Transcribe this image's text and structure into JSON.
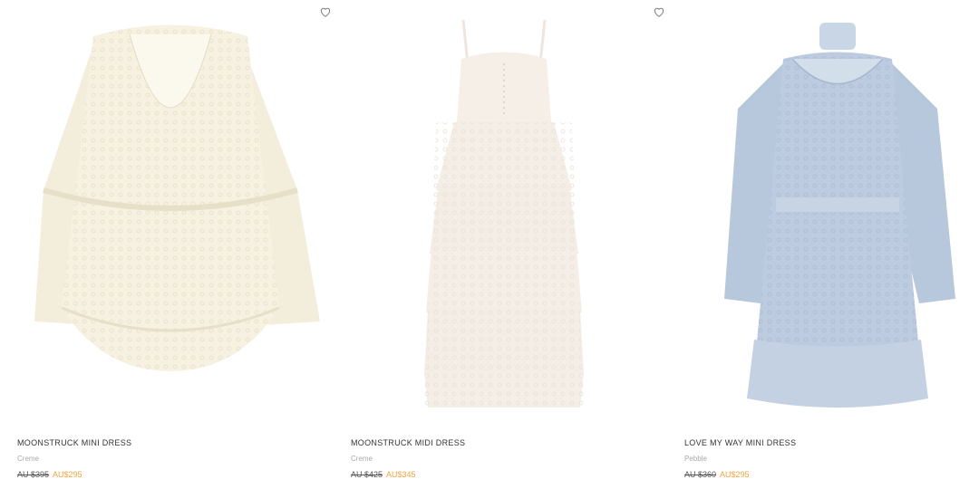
{
  "products": [
    {
      "name": "MOONSTRUCK MINI DRESS",
      "color": "Creme",
      "original_price": "AU $395",
      "sale_price": "AU$295",
      "image_tone": "#f4efdf"
    },
    {
      "name": "MOONSTRUCK MIDI DRESS",
      "color": "Creme",
      "original_price": "AU $425",
      "sale_price": "AU$345",
      "image_tone": "#f3ede6"
    },
    {
      "name": "LOVE MY WAY MINI DRESS",
      "color": "Pebble",
      "original_price": "AU $360",
      "sale_price": "AU$295",
      "image_tone": "#b9c9dd"
    }
  ],
  "icons": {
    "wishlist": "heart-outline-icon"
  },
  "colors": {
    "sale": "#f0a53c",
    "background": "#ffffff"
  }
}
